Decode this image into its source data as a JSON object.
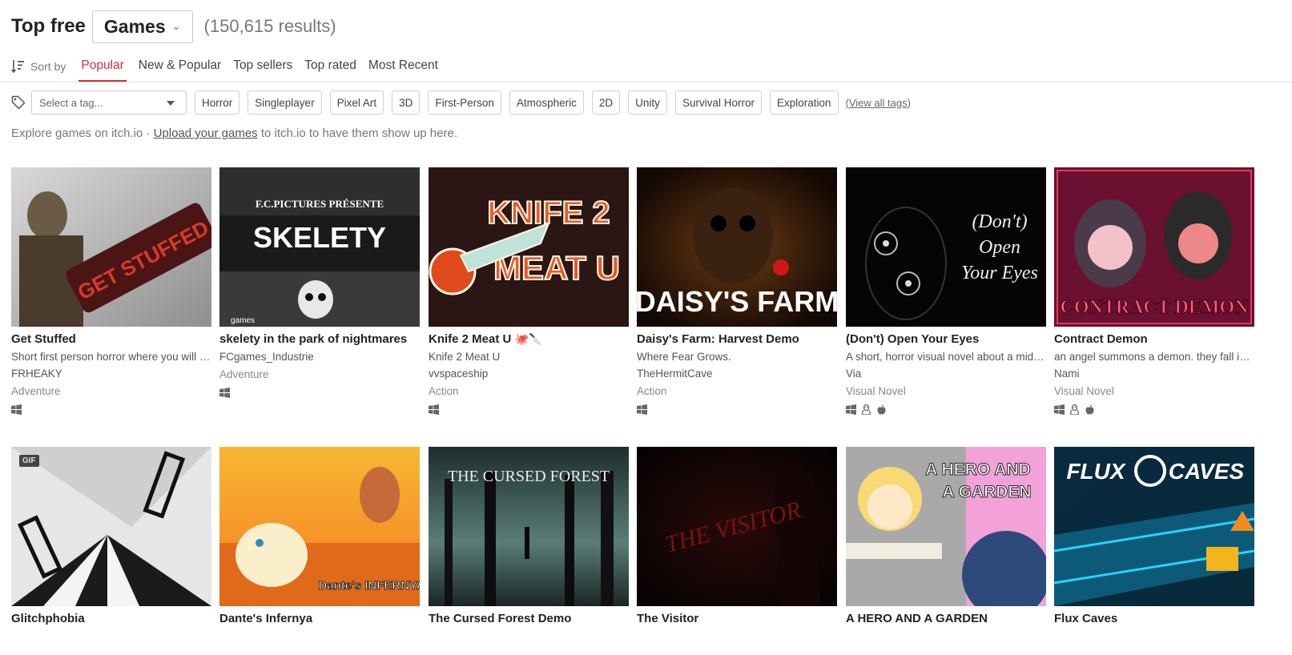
{
  "header": {
    "title": "Top free",
    "category": "Games",
    "results": "(150,615 results)"
  },
  "sort": {
    "label": "Sort by",
    "tabs": [
      {
        "label": "Popular",
        "active": true
      },
      {
        "label": "New & Popular"
      },
      {
        "label": "Top sellers"
      },
      {
        "label": "Top rated"
      },
      {
        "label": "Most Recent"
      }
    ]
  },
  "tags": {
    "placeholder": "Select a tag...",
    "chips": [
      "Horror",
      "Singleplayer",
      "Pixel Art",
      "3D",
      "First-Person",
      "Atmospheric",
      "2D",
      "Unity",
      "Survival Horror",
      "Exploration"
    ],
    "view_all": "(View all tags)"
  },
  "explore": {
    "prefix": "Explore games on itch.io · ",
    "link": "Upload your games",
    "suffix": " to itch.io to have them show up here."
  },
  "games": [
    {
      "title": "Get Stuffed",
      "desc": "Short first person horror where you will have to escape from a psycho",
      "author": "FRHEAKY",
      "genre": "Adventure",
      "platforms": [
        "windows-icon"
      ],
      "thumb_text": "GET STUFFED"
    },
    {
      "title": "skelety in the park of nightmares",
      "desc": "",
      "author": "FCgames_Industrie",
      "genre": "Adventure",
      "platforms": [
        "windows-icon"
      ],
      "thumb_text": "SKELETY",
      "thumb_sub": "F.C.PICTURES PRÉSENTE",
      "thumb_sub2": "games"
    },
    {
      "title": "Knife 2 Meat U",
      "title_emoji": "🐙🔪",
      "desc": "Knife 2 Meat U",
      "author": "vvspaceship",
      "genre": "Action",
      "platforms": [
        "windows-icon"
      ],
      "thumb_text": "KNIFE 2",
      "thumb_sub": "MEAT U"
    },
    {
      "title": "Daisy's Farm: Harvest Demo",
      "desc": "Where Fear Grows.",
      "author": "TheHermitCave",
      "genre": "Action",
      "platforms": [
        "windows-icon"
      ],
      "thumb_text": "DAISY'S FARM"
    },
    {
      "title": "(Don't) Open Your Eyes",
      "desc": "A short, horror visual novel about a midnight encounter",
      "author": "Via",
      "genre": "Visual Novel",
      "platforms": [
        "windows-icon",
        "linux-icon",
        "apple-icon"
      ],
      "thumb_text": "(Don't)",
      "thumb_sub": "Open",
      "thumb_sub2": "Your Eyes"
    },
    {
      "title": "Contract Demon",
      "desc": "an angel summons a demon. they fall in love",
      "author": "Nami",
      "genre": "Visual Novel",
      "platforms": [
        "windows-icon",
        "linux-icon",
        "apple-icon"
      ],
      "thumb_text": "CONTRACT DEMON"
    },
    {
      "title": "Glitchphobia",
      "gif": "GIF"
    },
    {
      "title": "Dante's Infernya",
      "thumb_text": "Dante's INFERNYA"
    },
    {
      "title": "The Cursed Forest Demo",
      "thumb_text": "THE CURSED FOREST"
    },
    {
      "title": "The Visitor",
      "thumb_text": "THE VISITOR"
    },
    {
      "title": "A HERO AND A GARDEN",
      "thumb_text": "A HERO AND",
      "thumb_sub": "A GARDEN"
    },
    {
      "title": "Flux Caves",
      "thumb_text": "FLUX",
      "thumb_sub": "CAVES"
    }
  ],
  "colors": {
    "accent": "#da2c38",
    "text": "#222222",
    "muted": "#777777"
  }
}
